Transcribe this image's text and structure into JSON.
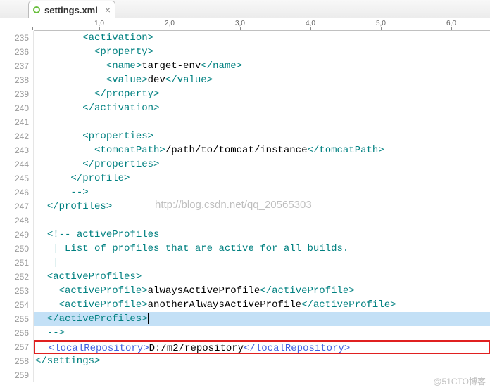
{
  "tab": {
    "filename": "settings.xml"
  },
  "ruler_ticks": [
    {
      "label": "",
      "col": 0
    },
    {
      "label": "1,0",
      "col": 10
    },
    {
      "label": "2,0",
      "col": 20
    },
    {
      "label": "3,0",
      "col": 30
    },
    {
      "label": "4,0",
      "col": 40
    },
    {
      "label": "5,0",
      "col": 50
    },
    {
      "label": "6,0",
      "col": 60
    }
  ],
  "first_line": 235,
  "last_line": 259,
  "code": {
    "l235": {
      "i": "        ",
      "t": "<activation>"
    },
    "l236": {
      "i": "          ",
      "t": "<property>"
    },
    "l237": {
      "i": "            ",
      "t1": "<name>",
      "v": "target-env",
      "t2": "</name>"
    },
    "l238": {
      "i": "            ",
      "t1": "<value>",
      "v": "dev",
      "t2": "</value>"
    },
    "l239": {
      "i": "          ",
      "t": "</property>"
    },
    "l240": {
      "i": "        ",
      "t": "</activation>"
    },
    "l241": {
      "i": ""
    },
    "l242": {
      "i": "        ",
      "t": "<properties>"
    },
    "l243": {
      "i": "          ",
      "t1": "<tomcatPath>",
      "v": "/path/to/tomcat/instance",
      "t2": "</tomcatPath>"
    },
    "l244": {
      "i": "        ",
      "t": "</properties>"
    },
    "l245": {
      "i": "      ",
      "t": "</profile>"
    },
    "l246": {
      "i": "      ",
      "t": "-->"
    },
    "l247": {
      "i": "  ",
      "t": "</profiles>"
    },
    "l248": {
      "i": ""
    },
    "l249": {
      "i": "  ",
      "t": "<!-- activeProfiles"
    },
    "l250": {
      "i": "   | ",
      "t": "List of profiles that are active for all builds."
    },
    "l251": {
      "i": "   |"
    },
    "l252": {
      "i": "  ",
      "t": "<activeProfiles>"
    },
    "l253": {
      "i": "    ",
      "t1": "<activeProfile>",
      "v": "alwaysActiveProfile",
      "t2": "</activeProfile>"
    },
    "l254": {
      "i": "    ",
      "t1": "<activeProfile>",
      "v": "anotherAlwaysActiveProfile",
      "t2": "</activeProfile>"
    },
    "l255": {
      "i": "  ",
      "t": "</activeProfiles>"
    },
    "l256": {
      "i": "  ",
      "t": "-->"
    },
    "l257": {
      "i": "  ",
      "t1": "<localRepository>",
      "v": "D:/m2/repository",
      "t2": "</localRepository>"
    },
    "l258": {
      "i": "",
      "t": "</settings>"
    },
    "l259": {
      "i": ""
    }
  },
  "watermark_url": "http://blog.csdn.net/qq_20565303",
  "watermark_corner": "@51CTO博客"
}
